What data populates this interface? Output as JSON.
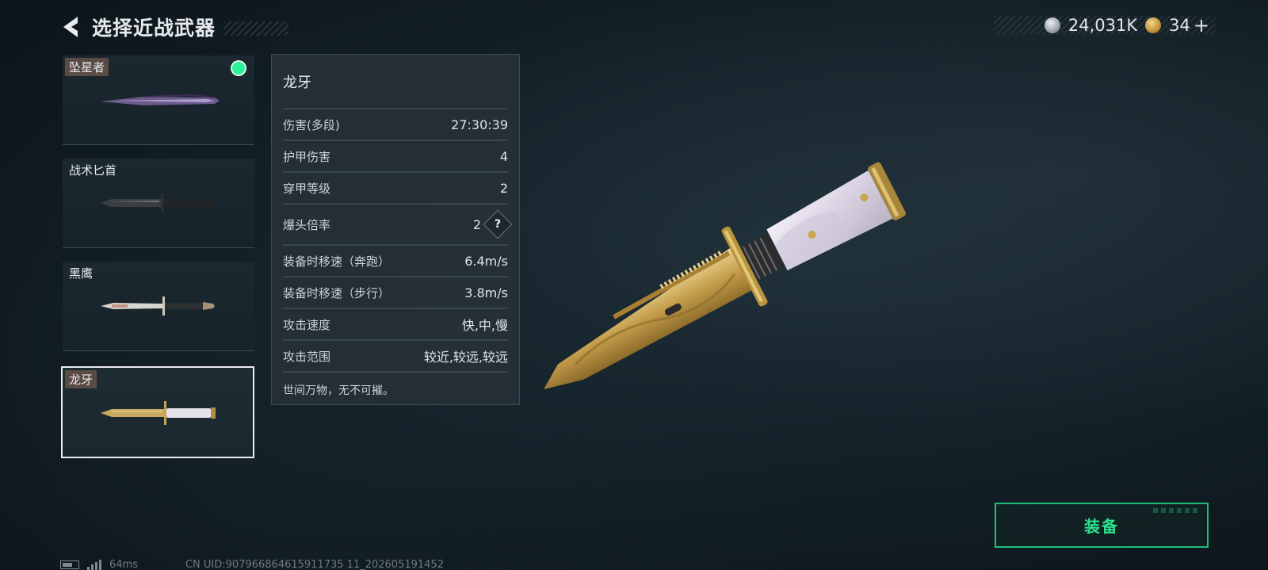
{
  "header": {
    "title": "选择近战武器"
  },
  "currency": {
    "silver": "24,031K",
    "gold": "34",
    "plus": "+"
  },
  "weapons": [
    {
      "name": "坠星者",
      "equipped": true,
      "selected": false,
      "tagged": true
    },
    {
      "name": "战术匕首",
      "equipped": false,
      "selected": false,
      "tagged": false
    },
    {
      "name": "黑鹰",
      "equipped": false,
      "selected": false,
      "tagged": false
    },
    {
      "name": "龙牙",
      "equipped": false,
      "selected": true,
      "tagged": true
    }
  ],
  "detail": {
    "name": "龙牙",
    "stats": [
      {
        "label": "伤害(多段)",
        "value": "27:30:39"
      },
      {
        "label": "护甲伤害",
        "value": "4"
      },
      {
        "label": "穿甲等级",
        "value": "2"
      },
      {
        "label": "爆头倍率",
        "value": "2"
      },
      {
        "label": "装备时移速（奔跑）",
        "value": "6.4m/s"
      },
      {
        "label": "装备时移速（步行）",
        "value": "3.8m/s"
      },
      {
        "label": "攻击速度",
        "value": "快,中,慢"
      },
      {
        "label": "攻击范围",
        "value": "较近,较远,较远"
      }
    ],
    "help_symbol": "?",
    "description": "世间万物，无不可摧。"
  },
  "equip_button": {
    "label": "装备"
  },
  "footer": {
    "ping": "64ms",
    "uid": "CN UID:907966864615911735 11_202605191452"
  },
  "colors": {
    "accent_green": "#2be28e",
    "equipped_dot": "#2cf09a",
    "panel_bg": "#263037"
  },
  "icons": {
    "back": "chevron-left-icon",
    "silver_coin": "silver-coin-icon",
    "gold_coin": "gold-coin-icon",
    "help": "question-diamond-icon"
  }
}
